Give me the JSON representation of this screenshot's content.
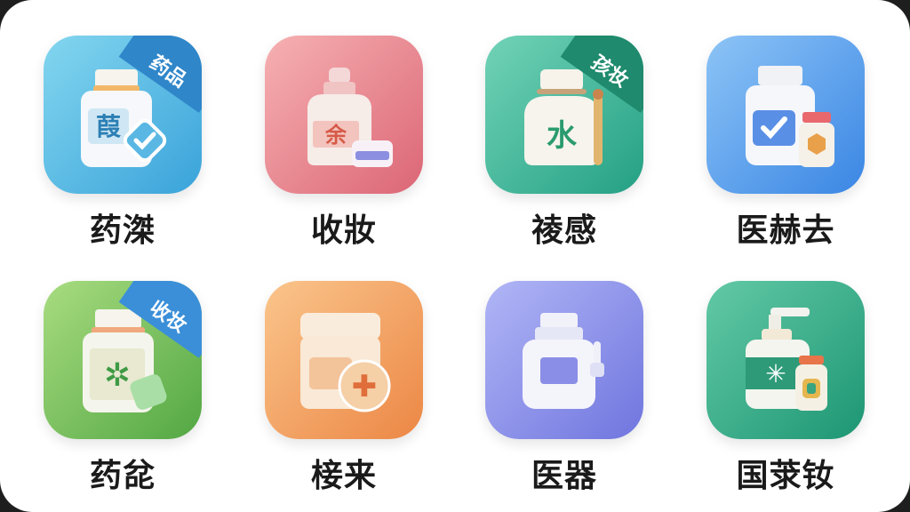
{
  "tiles": [
    {
      "label": "药滐",
      "badge": "药品",
      "color_a": "#7dd3ee",
      "color_b": "#3ba9dc",
      "badge_color": "#2f86c9",
      "glyph": "葭"
    },
    {
      "label": "收妝",
      "badge": "",
      "color_a": "#f4a6a9",
      "color_b": "#de6b77",
      "badge_color": "",
      "glyph": "余"
    },
    {
      "label": "祾感",
      "badge": "孩妆",
      "color_a": "#6fd1b6",
      "color_b": "#27a68a",
      "badge_color": "#1f8a6d",
      "glyph": "⽔"
    },
    {
      "label": "医赫去",
      "badge": "",
      "color_a": "#86bff5",
      "color_b": "#3b87e6",
      "badge_color": "",
      "glyph": "✓"
    },
    {
      "label": "药兺",
      "badge": "收妆",
      "color_a": "#a5db7d",
      "color_b": "#58ad47",
      "badge_color": "#3b8fd8",
      "glyph": "✲"
    },
    {
      "label": "椄来",
      "badge": "",
      "color_a": "#f9c189",
      "color_b": "#ef8d4a",
      "badge_color": "",
      "glyph": "✚"
    },
    {
      "label": "医器",
      "badge": "",
      "color_a": "#aeb2f5",
      "color_b": "#7479e1",
      "badge_color": "",
      "glyph": ""
    },
    {
      "label": "国莍钕",
      "badge": "",
      "color_a": "#5fc6a3",
      "color_b": "#1e9975",
      "badge_color": "",
      "glyph": "✳"
    }
  ]
}
